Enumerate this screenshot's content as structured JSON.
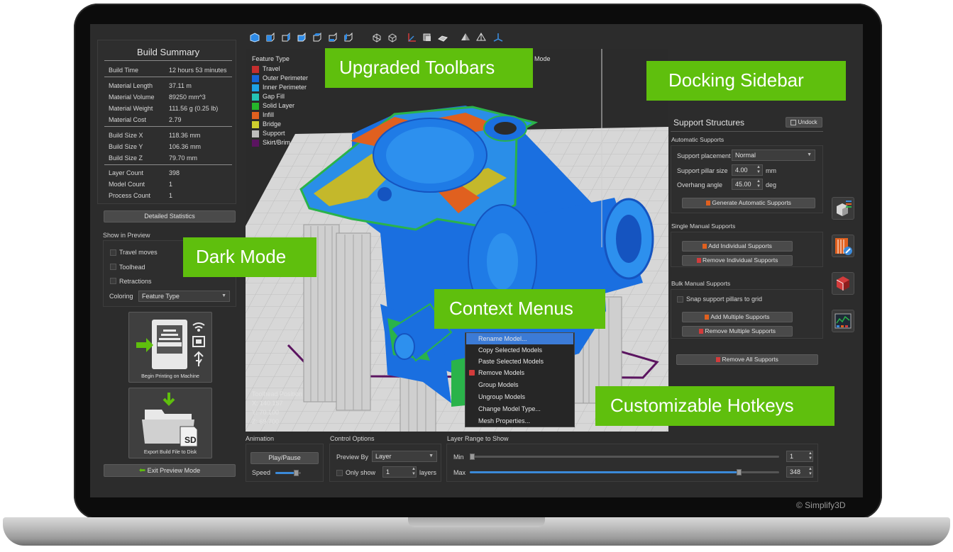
{
  "brand": {
    "copyright": "© Simplify3D",
    "accent": "#5fbf0d"
  },
  "callouts": {
    "toolbars": "Upgraded Toolbars",
    "sidebar": "Docking Sidebar",
    "dark_mode": "Dark Mode",
    "context_menus": "Context Menus",
    "hotkeys": "Customizable Hotkeys"
  },
  "build_summary": {
    "title": "Build Summary",
    "rows": [
      {
        "label": "Build Time",
        "value": "12 hours 53 minutes"
      },
      {
        "label": "Material Length",
        "value": "37.11 m"
      },
      {
        "label": "Material Volume",
        "value": "89250 mm^3"
      },
      {
        "label": "Material Weight",
        "value": "111.56 g (0.25 lb)"
      },
      {
        "label": "Material Cost",
        "value": "2.79"
      },
      {
        "label": "Build Size X",
        "value": "118.36 mm"
      },
      {
        "label": "Build Size Y",
        "value": "106.36 mm"
      },
      {
        "label": "Build Size Z",
        "value": "79.70 mm"
      },
      {
        "label": "Layer Count",
        "value": "398"
      },
      {
        "label": "Model Count",
        "value": "1"
      },
      {
        "label": "Process Count",
        "value": "1"
      }
    ],
    "detailed_button": "Detailed Statistics"
  },
  "show_in_preview": {
    "title": "Show in Preview",
    "options": [
      "Travel moves",
      "Toolhead",
      "Retractions"
    ],
    "coloring_label": "Coloring",
    "coloring_value": "Feature Type"
  },
  "machine": {
    "print_label": "Begin Printing on Machine",
    "export_label": "Export Build File to Disk",
    "sd_label": "SD",
    "exit_button": "Exit Preview Mode"
  },
  "viewport": {
    "legend_title": "Feature Type",
    "mode_label": "Mode",
    "legend": [
      {
        "name": "Travel",
        "color": "#c42e2e"
      },
      {
        "name": "Outer Perimeter",
        "color": "#1565d8"
      },
      {
        "name": "Inner Perimeter",
        "color": "#1ea1e6"
      },
      {
        "name": "Gap Fill",
        "color": "#24c2b5"
      },
      {
        "name": "Solid Layer",
        "color": "#25b62a"
      },
      {
        "name": "Infill",
        "color": "#e0601f"
      },
      {
        "name": "Bridge",
        "color": "#cfcf2e"
      },
      {
        "name": "Support",
        "color": "#bdbdbd"
      },
      {
        "name": "Skirt/Brim",
        "color": "#5b1460"
      }
    ],
    "toolhead_title": "Toolhead Position",
    "toolhead": [
      "X: 140.157",
      "Y: 70.100",
      "Z: 69.700"
    ]
  },
  "context_menu": {
    "items": [
      "Rename Model...",
      "Copy Selected Models",
      "Paste Selected Models",
      "Remove Models",
      "Group Models",
      "Ungroup Models",
      "Change Model Type...",
      "Mesh Properties..."
    ]
  },
  "support": {
    "title": "Support Structures",
    "undock": "Undock",
    "automatic_title": "Automatic Supports",
    "placement_label": "Support placement",
    "placement_value": "Normal",
    "pillar_label": "Support pillar size",
    "pillar_value": "4.00",
    "pillar_unit": "mm",
    "angle_label": "Overhang angle",
    "angle_value": "45.00",
    "angle_unit": "deg",
    "generate_button": "Generate Automatic Supports",
    "single_title": "Single Manual Supports",
    "add_individual": "Add Individual Supports",
    "remove_individual": "Remove Individual Supports",
    "bulk_title": "Bulk Manual Supports",
    "snap_label": "Snap support pillars to grid",
    "add_multiple": "Add Multiple Supports",
    "remove_multiple": "Remove Multiple Supports",
    "remove_all": "Remove All Supports"
  },
  "animation": {
    "title": "Animation",
    "play_button": "Play/Pause",
    "speed_label": "Speed",
    "speed_fraction": 0.8
  },
  "control": {
    "title": "Control Options",
    "preview_label": "Preview By",
    "preview_value": "Layer",
    "only_label": "Only show",
    "only_value": "1",
    "layers_label": "layers"
  },
  "layer_range": {
    "title": "Layer Range to Show",
    "min_label": "Min",
    "min_value": "1",
    "max_label": "Max",
    "max_value": "348",
    "max_fraction": 0.87
  }
}
